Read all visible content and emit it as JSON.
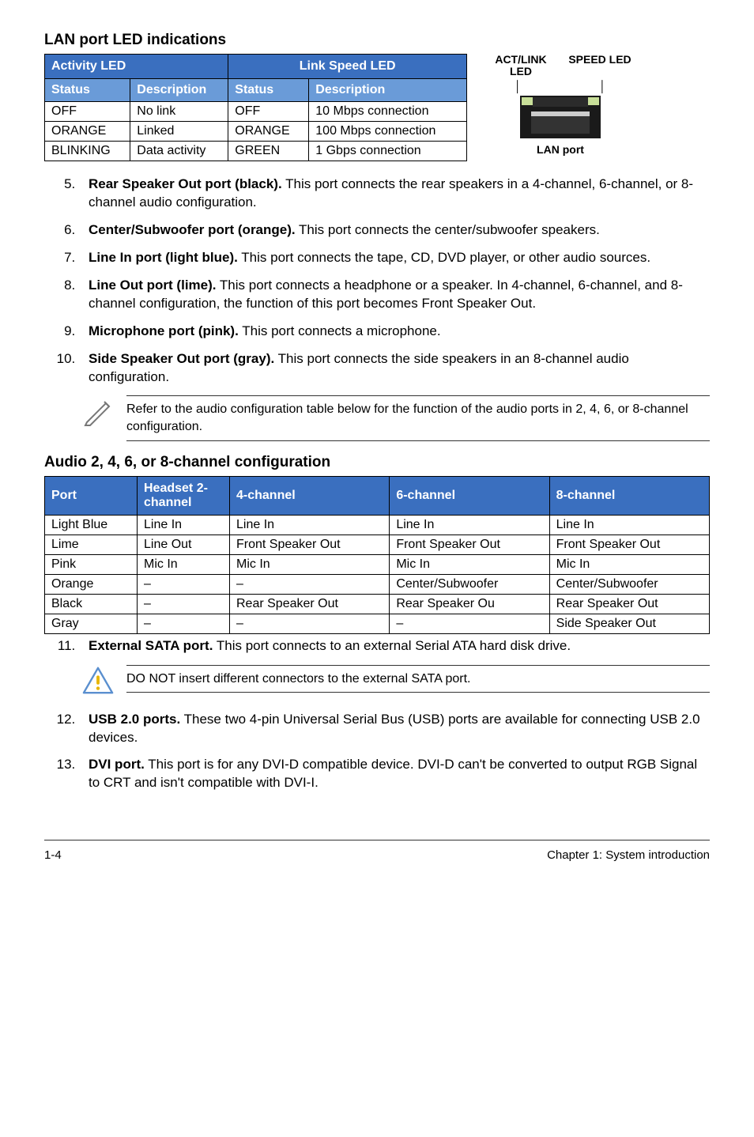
{
  "section1_title": "LAN port LED indications",
  "led_headers": {
    "activity": "Activity LED",
    "link": "Link Speed LED"
  },
  "led_subheaders": {
    "status1": "Status",
    "desc1": "Description",
    "status2": "Status",
    "desc2": "Description"
  },
  "led_rows": [
    {
      "s1": "OFF",
      "d1": "No link",
      "s2": "OFF",
      "d2": "10 Mbps connection"
    },
    {
      "s1": "ORANGE",
      "d1": "Linked",
      "s2": "ORANGE",
      "d2": "100 Mbps connection"
    },
    {
      "s1": "BLINKING",
      "d1": "Data activity",
      "s2": "GREEN",
      "d2": "1 Gbps connection"
    }
  ],
  "lan_labels": {
    "act": "ACT/LINK LED",
    "speed": "SPEED LED",
    "port": "LAN port"
  },
  "features_a": [
    {
      "n": "5.",
      "label": "Rear Speaker Out port (black).",
      "text": " This port connects the rear speakers in a 4-channel, 6-channel, or 8-channel audio configuration."
    },
    {
      "n": "6.",
      "label": "Center/Subwoofer port (orange).",
      "text": " This port connects the center/subwoofer speakers."
    },
    {
      "n": "7.",
      "label": "Line In port (light blue).",
      "text": " This port connects the tape, CD, DVD player, or other audio sources."
    },
    {
      "n": "8.",
      "label": "Line Out port (lime).",
      "text": " This port connects a headphone or a speaker. In 4-channel, 6-channel, and 8-channel configuration, the function of this port becomes Front Speaker Out."
    },
    {
      "n": "9.",
      "label": "Microphone port (pink).",
      "text": " This port connects a microphone."
    },
    {
      "n": "10.",
      "label": "Side Speaker Out port (gray).",
      "text": " This port connects the side speakers in an 8-channel audio configuration."
    }
  ],
  "note_pencil": "Refer to the audio configuration table below for the function of the audio ports in 2, 4, 6, or 8-channel configuration.",
  "section2_title": "Audio 2, 4, 6, or 8-channel configuration",
  "audio_headers": {
    "port": "Port",
    "h2": "Headset 2-channel",
    "c4": "4-channel",
    "c6": "6-channel",
    "c8": "8-channel"
  },
  "audio_rows": [
    {
      "port": "Light Blue",
      "h2": "Line In",
      "c4": "Line In",
      "c6": "Line In",
      "c8": "Line In"
    },
    {
      "port": "Lime",
      "h2": "Line Out",
      "c4": "Front Speaker Out",
      "c6": "Front Speaker Out",
      "c8": "Front Speaker Out"
    },
    {
      "port": "Pink",
      "h2": "Mic In",
      "c4": "Mic In",
      "c6": "Mic In",
      "c8": "Mic In"
    },
    {
      "port": "Orange",
      "h2": "–",
      "c4": "–",
      "c6": "Center/Subwoofer",
      "c8": "Center/Subwoofer"
    },
    {
      "port": "Black",
      "h2": "–",
      "c4": "Rear Speaker Out",
      "c6": "Rear Speaker Ou",
      "c8": "Rear Speaker Out"
    },
    {
      "port": "Gray",
      "h2": "–",
      "c4": "–",
      "c6": "–",
      "c8": "Side Speaker Out"
    }
  ],
  "features_b": [
    {
      "n": "11.",
      "label": "External SATA port.",
      "text": " This port connects to an external Serial ATA hard disk drive."
    }
  ],
  "note_warning": "DO NOT insert different connectors to the external SATA port.",
  "features_c": [
    {
      "n": "12.",
      "label": "USB 2.0 ports.",
      "text": " These two 4-pin Universal Serial Bus (USB) ports are available for connecting USB 2.0 devices."
    },
    {
      "n": "13.",
      "label": "DVI port.",
      "text": " This port is for any DVI-D compatible device. DVI-D can't be converted to output RGB Signal to CRT and isn't compatible with DVI-I."
    }
  ],
  "footer": {
    "left": "1-4",
    "right": "Chapter 1: System introduction"
  }
}
